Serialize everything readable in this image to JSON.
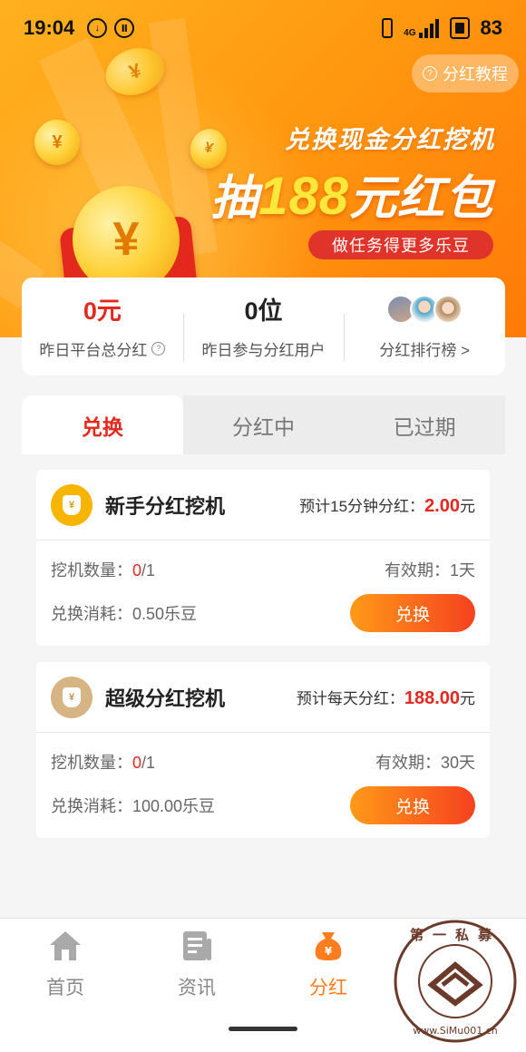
{
  "status_bar": {
    "time": "19:04",
    "network": "4G",
    "battery": "83"
  },
  "hero": {
    "tutorial_label": "分红教程",
    "subtitle": "兑换现金分红挖机",
    "title_prefix": "抽",
    "title_number": "188",
    "title_suffix": "元红包",
    "task_button": "做任务得更多乐豆",
    "coin_symbol": "¥"
  },
  "stats": {
    "total_dividend_value": "0元",
    "total_dividend_label": "昨日平台总分红",
    "participants_value": "0位",
    "participants_label": "昨日参与分红用户",
    "ranking_label": "分红排行榜 >"
  },
  "tabs": [
    "兑换",
    "分红中",
    "已过期"
  ],
  "active_tab": 0,
  "cards": [
    {
      "name": "新手分红挖机",
      "estimate_label": "预计15分钟分红：",
      "estimate_amount": "2.00",
      "estimate_unit": "元",
      "count_label": "挖机数量：",
      "count_value": "0",
      "count_total": "/1",
      "validity": "有效期：1天",
      "cost": "兑换消耗：0.50乐豆",
      "button": "兑换",
      "icon": "money-bag-icon",
      "icon_color": "#f7b500"
    },
    {
      "name": "超级分红挖机",
      "estimate_label": "预计每天分红：",
      "estimate_amount": "188.00",
      "estimate_unit": "元",
      "count_label": "挖机数量：",
      "count_value": "0",
      "count_total": "/1",
      "validity": "有效期：30天",
      "cost": "兑换消耗：100.00乐豆",
      "button": "兑换",
      "icon": "money-bag-icon",
      "icon_color": "#d6b484"
    }
  ],
  "nav": [
    {
      "label": "首页",
      "icon": "home-icon"
    },
    {
      "label": "资讯",
      "icon": "news-icon"
    },
    {
      "label": "分红",
      "icon": "dividend-bag-icon",
      "active": true
    }
  ],
  "watermark": {
    "top": "第一私募",
    "url": "www.SiMu001.cn"
  },
  "colors": {
    "accent_red": "#e5281e",
    "accent_orange": "#ff7d1e",
    "hero_orange": "#ff9a10"
  }
}
